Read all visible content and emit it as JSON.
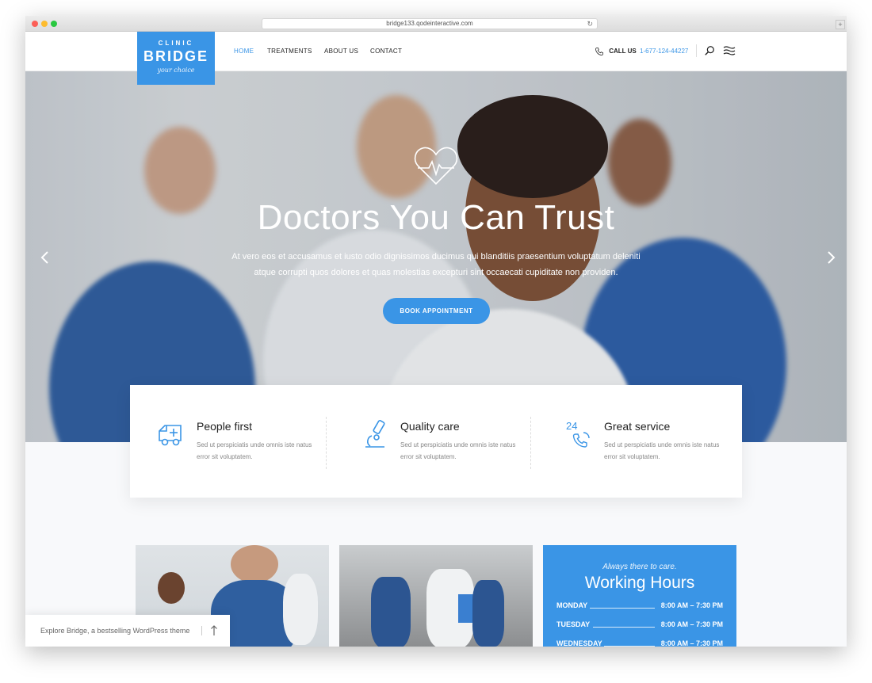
{
  "browser": {
    "url": "bridge133.qodeinteractive.com"
  },
  "logo": {
    "small": "CLINIC",
    "main": "BRIDGE",
    "script": "your choice"
  },
  "nav": {
    "items": [
      "HOME",
      "TREATMENTS",
      "ABOUT US",
      "CONTACT"
    ],
    "active": "HOME"
  },
  "call": {
    "label": "CALL US",
    "number": "1-677-124-44227"
  },
  "hero": {
    "title": "Doctors You Can Trust",
    "text": "At vero eos et accusamus et iusto odio dignissimos ducimus qui blanditiis praesentium voluptatum deleniti atque corrupti quos dolores et quas molestias excepturi sint occaecati cupiditate non providen.",
    "button": "BOOK APPOINTMENT"
  },
  "features": [
    {
      "title": "People first",
      "text": "Sed ut perspiciatis unde omnis iste natus error sit voluptatem.",
      "icon": "ambulance-icon"
    },
    {
      "title": "Quality care",
      "text": "Sed ut perspiciatis unde omnis iste natus error sit voluptatem.",
      "icon": "microscope-icon"
    },
    {
      "title": "Great service",
      "text": "Sed ut perspiciatis unde omnis iste natus error sit voluptatem.",
      "icon": "phone-24-icon",
      "icon_text": "24"
    }
  ],
  "hours": {
    "subtitle": "Always there to care.",
    "title": "Working Hours",
    "rows": [
      {
        "day": "MONDAY",
        "time": "8:00 AM – 7:30 PM"
      },
      {
        "day": "TUESDAY",
        "time": "8:00 AM – 7:30 PM"
      },
      {
        "day": "WEDNESDAY",
        "time": "8:00 AM – 7:30 PM"
      }
    ]
  },
  "explore": {
    "text": "Explore Bridge, a bestselling WordPress theme"
  },
  "colors": {
    "accent": "#3a95e6",
    "text": "#222222",
    "muted": "#888888"
  }
}
